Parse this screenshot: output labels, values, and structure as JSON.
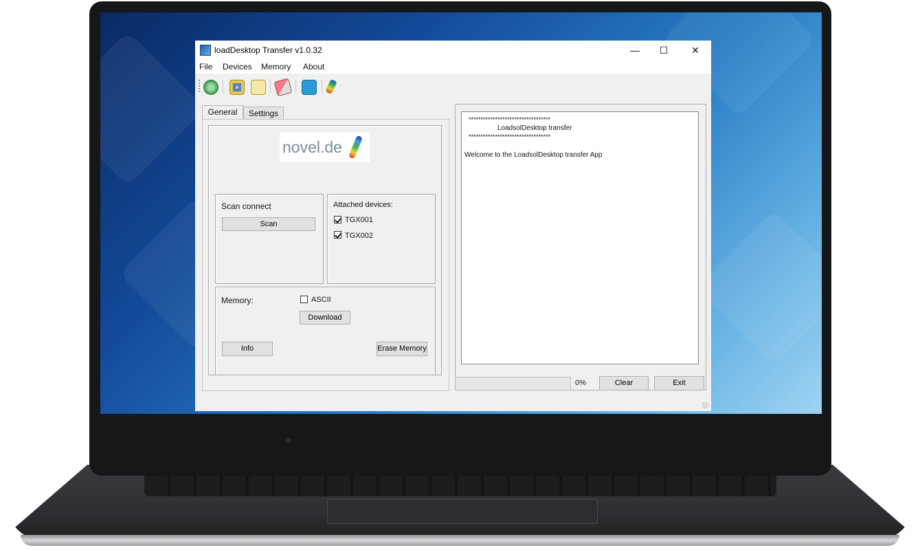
{
  "window": {
    "title": "loadDesktop Transfer v1.0.32",
    "controls": {
      "minimize": "—",
      "maximize": "☐",
      "close": "✕"
    }
  },
  "menu": [
    "File",
    "Devices",
    "Memory",
    "About"
  ],
  "toolbar_icons": [
    "refresh-icon",
    "device-icon",
    "file-icon",
    "eraser-icon",
    "info-icon",
    "foot-icon"
  ],
  "tabs": {
    "general": "General",
    "settings": "Settings"
  },
  "logo": {
    "text": "novel.de"
  },
  "scan": {
    "heading": "Scan connect",
    "button": "Scan"
  },
  "devices": {
    "heading": "Attached devices:",
    "items": [
      {
        "label": "TGX001",
        "checked": true
      },
      {
        "label": "TGX002",
        "checked": true
      }
    ]
  },
  "memory": {
    "heading": "Memory:",
    "ascii_label": "ASCII",
    "ascii_checked": false,
    "download": "Download",
    "info": "Info",
    "erase": "Erase Memory"
  },
  "console": {
    "line1": "**********************************",
    "line2": "LoadsolDesktop transfer",
    "line3": "**********************************",
    "line4": "Welcome to the LoadsolDesktop transfer App"
  },
  "footer": {
    "progress": 0,
    "progress_text": "0%",
    "clear": "Clear",
    "exit": "Exit"
  }
}
